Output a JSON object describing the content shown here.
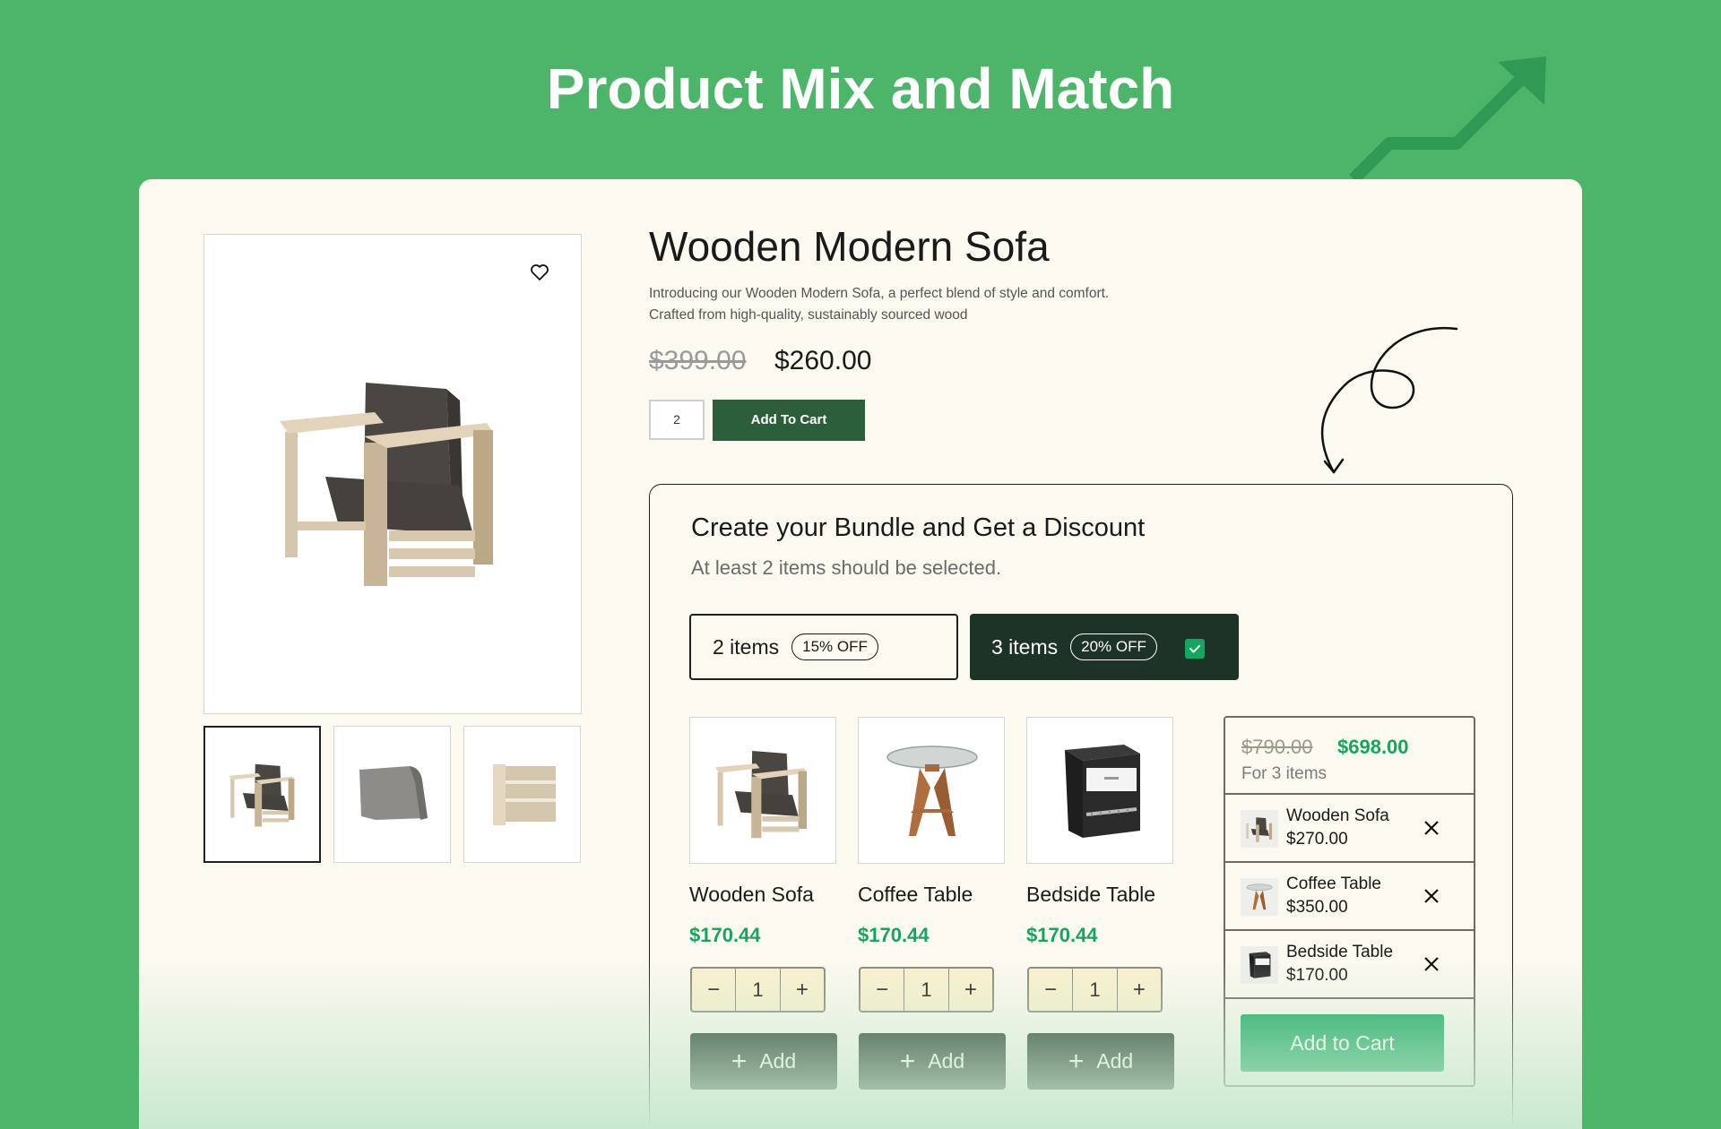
{
  "banner": {
    "title": "Product Mix and Match"
  },
  "colors": {
    "background": "#4db56a",
    "card": "#fcf9f0",
    "accent_green": "#13a65e",
    "dark_green": "#1e3327",
    "button_green": "#2d5e3c"
  },
  "icons": {
    "wishlist": "heart-icon",
    "trend": "trend-up-arrow-icon",
    "doodle": "curly-arrow-icon",
    "remove": "close-icon",
    "add": "plus-icon",
    "decrease": "minus-icon",
    "increase": "plus-icon",
    "selected": "checkbox-checked-icon"
  },
  "product": {
    "title": "Wooden Modern Sofa",
    "description": "Introducing our Wooden Modern Sofa, a perfect blend of style and comfort. Crafted from high-quality, sustainably sourced wood",
    "old_price": "$399.00",
    "price": "$260.00",
    "quantity": "2",
    "add_button": "Add To Cart"
  },
  "bundle": {
    "title": "Create your Bundle and Get a Discount",
    "subtitle": "At least 2 items should be selected.",
    "tiers": [
      {
        "label": "2 items",
        "badge": "15% OFF",
        "selected": false
      },
      {
        "label": "3 items",
        "badge": "20% OFF",
        "selected": true
      }
    ],
    "items": [
      {
        "name": "Wooden Sofa",
        "price": "$170.44",
        "qty": "1",
        "minus": "−",
        "plus": "+",
        "add_label": "Add",
        "add_icon": "+"
      },
      {
        "name": "Coffee Table",
        "price": "$170.44",
        "qty": "1",
        "minus": "−",
        "plus": "+",
        "add_label": "Add",
        "add_icon": "+"
      },
      {
        "name": "Bedside Table",
        "price": "$170.44",
        "qty": "1",
        "minus": "−",
        "plus": "+",
        "add_label": "Add",
        "add_icon": "+"
      }
    ],
    "summary": {
      "old_total": "$790.00",
      "total": "$698.00",
      "count_label": "For 3 items",
      "lines": [
        {
          "name": "Wooden Sofa",
          "price": "$270.00"
        },
        {
          "name": "Coffee Table",
          "price": "$350.00"
        },
        {
          "name": "Bedside Table",
          "price": "$170.00"
        }
      ],
      "cart_button": "Add to Cart"
    }
  }
}
